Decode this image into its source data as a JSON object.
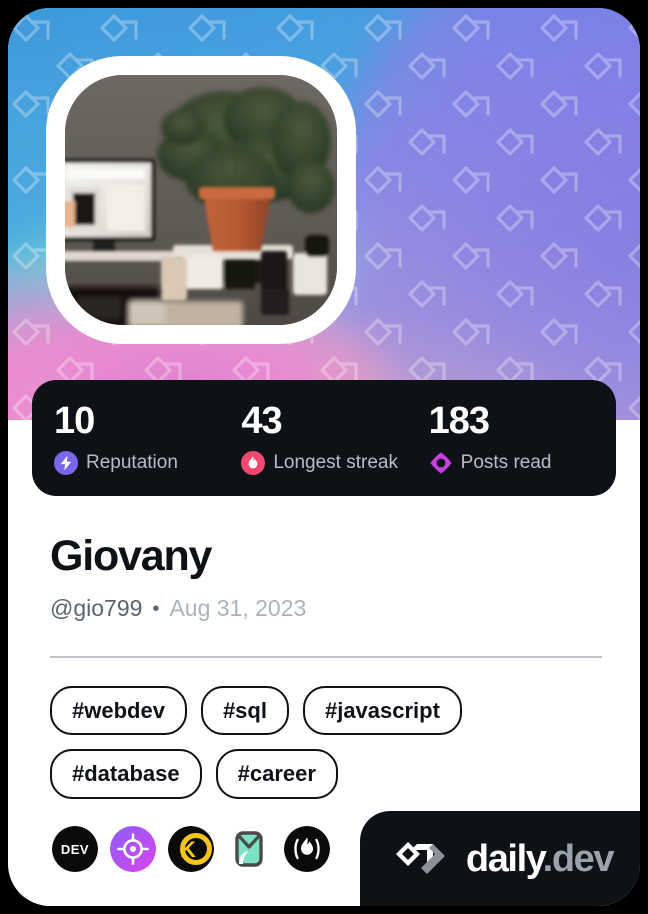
{
  "card": {
    "cover": {
      "pattern_icon": "daily-dev-chevron-watermark",
      "gradient_colors": [
        "#3f9fdd",
        "#63a5f2",
        "#7d79e6",
        "#e79bd0",
        "#f6c79a",
        "#8fe3d2"
      ]
    },
    "avatar": {
      "alt": "desk with monitor and potted plant",
      "border_color": "#ffffff"
    }
  },
  "stats": [
    {
      "value": "10",
      "label": "Reputation",
      "icon": "bolt-icon",
      "icon_color": "#7a66e8"
    },
    {
      "value": "43",
      "label": "Longest streak",
      "icon": "flame-icon",
      "icon_color": "#f2486e"
    },
    {
      "value": "183",
      "label": "Posts read",
      "icon": "eye-icon",
      "icon_color": "#c640e0"
    }
  ],
  "profile": {
    "name": "Giovany",
    "handle": "@gio799",
    "separator": "•",
    "joined": "Aug 31, 2023"
  },
  "tags": [
    "#webdev",
    "#sql",
    "#javascript",
    "#database",
    "#career"
  ],
  "sources": [
    {
      "name": "dev-to-source-icon",
      "label": "DEV"
    },
    {
      "name": "target-source-icon",
      "label": ""
    },
    {
      "name": "kd-source-icon",
      "label": "KD"
    },
    {
      "name": "mint-leaf-source-icon",
      "label": ""
    },
    {
      "name": "flame-source-icon",
      "label": ""
    }
  ],
  "footer": {
    "logo_icon": "daily-dev-chevron-logo",
    "wordmark_primary": "daily",
    "wordmark_secondary": ".dev"
  }
}
